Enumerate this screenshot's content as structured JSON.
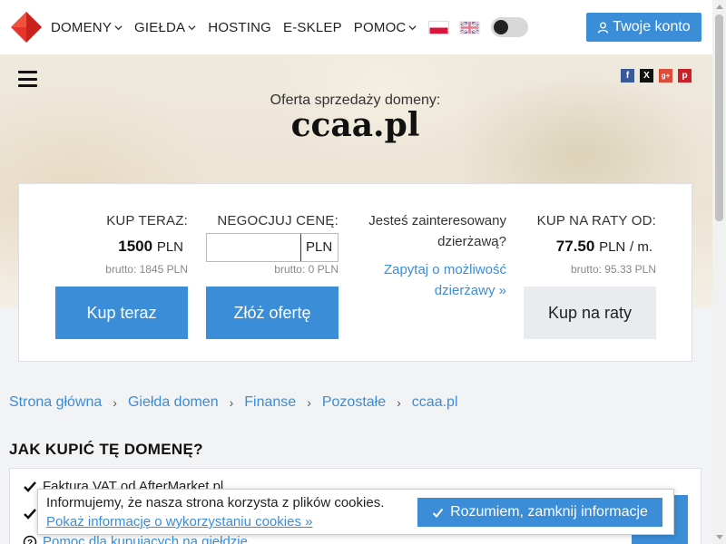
{
  "header": {
    "nav": [
      {
        "label": "DOMENY",
        "dropdown": true
      },
      {
        "label": "GIEŁDA",
        "dropdown": true
      },
      {
        "label": "HOSTING",
        "dropdown": false
      },
      {
        "label": "E-SKLEP",
        "dropdown": false
      },
      {
        "label": "POMOC",
        "dropdown": true
      }
    ],
    "flags": [
      "pl-flag-icon",
      "uk-flag-icon"
    ],
    "account_button": "Twoje konto"
  },
  "hero": {
    "subtitle": "Oferta sprzedaży domeny:",
    "domain": "ccaa.pl",
    "social": [
      "facebook-icon",
      "x-icon",
      "google-plus-icon",
      "pinterest-icon"
    ]
  },
  "offer": {
    "buy": {
      "label": "KUP TERAZ:",
      "price": "1500",
      "currency": "PLN",
      "brutto": "brutto: 1845 PLN",
      "button": "Kup teraz"
    },
    "negotiate": {
      "label": "NEGOCJUJ CENĘ:",
      "value": "",
      "currency": "PLN",
      "brutto": "brutto: 0 PLN",
      "button": "Złóż ofertę"
    },
    "lease": {
      "question": "Jesteś zainteresowany dzierżawą?",
      "link": "Zapytaj o możliwość dzierżawy »"
    },
    "installments": {
      "label": "KUP NA RATY OD:",
      "price": "77.50",
      "currency": "PLN",
      "period": "/ m.",
      "brutto": "brutto: 95.33 PLN",
      "button": "Kup na raty"
    }
  },
  "breadcrumb": [
    "Strona główna",
    "Giełda domen",
    "Finanse",
    "Pozostałe",
    "ccaa.pl"
  ],
  "how_to_buy": {
    "title": "JAK KUPIĆ TĘ DOMENĘ?",
    "items": [
      "Faktura VAT od AfterMarket.pl",
      "",
      "Pomoc dla kupujących na giełdzie"
    ]
  },
  "cookie": {
    "text": "Informujemy, że nasza strona korzysta z plików cookies.",
    "link": "Pokaż informację o wykorzystaniu cookies »",
    "button": "Rozumiem, zamknij informacje"
  },
  "colors": {
    "accent": "#3c8dd7",
    "logo": "#e8342c"
  }
}
